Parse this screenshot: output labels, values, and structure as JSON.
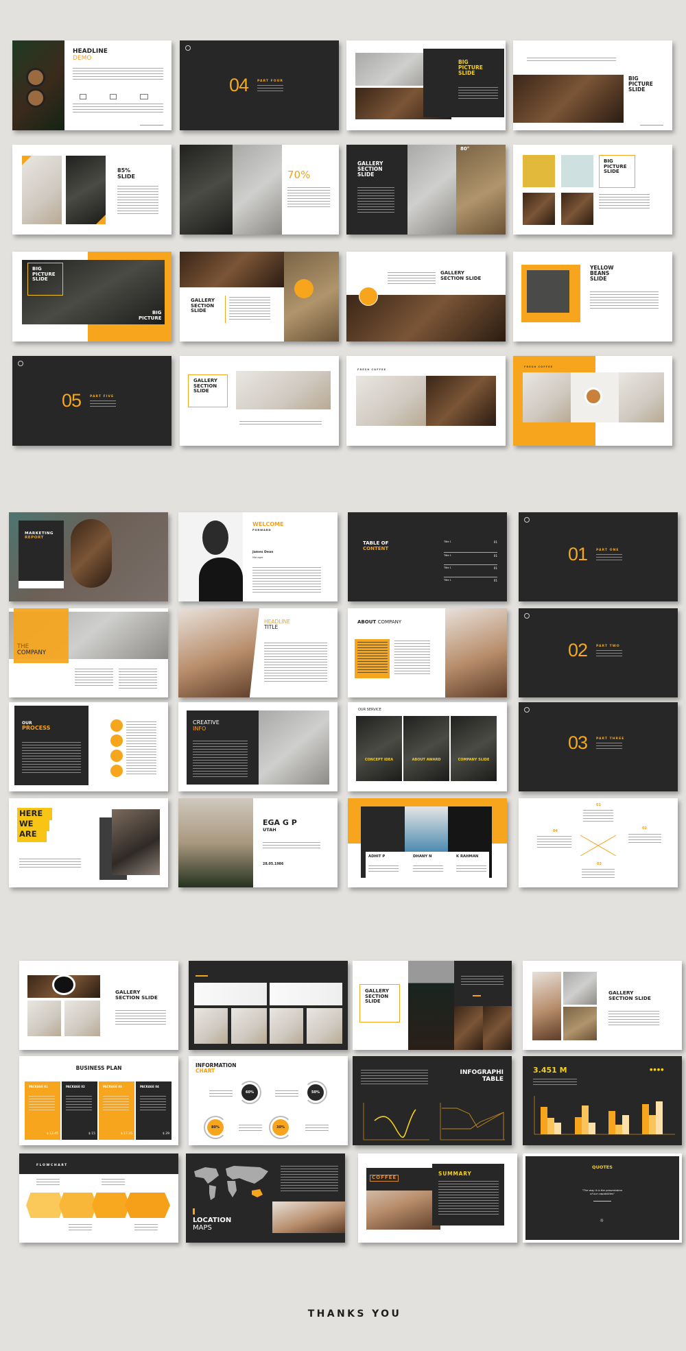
{
  "colors": {
    "background": "#e2e1de",
    "dark": "#272727",
    "orange": "#f6a51d",
    "yellow": "#f4d01e"
  },
  "section1": {
    "headline_demo": {
      "line1": "HEADLINE",
      "line2": "DEMO"
    },
    "part_four": {
      "number": "04",
      "label": "PART FOUR"
    },
    "big_picture_a": {
      "line1": "BIG",
      "line2": "PICTURE",
      "line3": "SLIDE"
    },
    "big_picture_b": {
      "line1": "BIG",
      "line2": "PICTURE",
      "line3": "SLIDE"
    },
    "slide_85": {
      "line1": "85%",
      "line2": "SLIDE"
    },
    "slide_70": {
      "value": "70%"
    },
    "gallery_a": {
      "line1": "GALLERY",
      "line2": "SECTION",
      "line3": "SLIDE",
      "badge": "80°"
    },
    "big_picture_c": {
      "line1": "BIG",
      "line2": "PICTURE",
      "line3": "SLIDE"
    },
    "big_picture_street": {
      "line1": "BIG",
      "line2": "PICTURE",
      "line3": "SLIDE",
      "corner1": "BIG",
      "corner2": "PICTURE"
    },
    "gallery_b": {
      "line1": "GALLERY",
      "line2": "SECTION",
      "line3": "SLIDE"
    },
    "gallery_c": {
      "line1": "GALLERY",
      "line2": "SECTION SLIDE"
    },
    "yellow_beans": {
      "line1": "YELLOW",
      "line2": "BEANS",
      "line3": "SLIDE"
    },
    "part_five": {
      "number": "05",
      "label": "PART FIVE"
    },
    "gallery_d": {
      "line1": "GALLERY",
      "line2": "SECTION",
      "line3": "SLIDE"
    },
    "fresh_coffee_a": {
      "label": "FRESH COFFEE"
    },
    "fresh_coffee_b": {
      "label": "FRESH COFFEE"
    }
  },
  "section2": {
    "marketing_report": {
      "line1": "MARKETING",
      "line2": "REPORT"
    },
    "welcome": {
      "line1": "WELCOME",
      "line2": "FORWARD",
      "name": "James Dean",
      "role": "Manager"
    },
    "toc": {
      "line1": "TABLE OF",
      "line2": "CONTENT",
      "items": [
        {
          "title": "Title 1",
          "num": "01"
        },
        {
          "title": "Title 1",
          "num": "01"
        },
        {
          "title": "Title 1",
          "num": "01"
        },
        {
          "title": "Title 1",
          "num": "01"
        }
      ]
    },
    "part_one": {
      "number": "01",
      "label": "PART ONE"
    },
    "the_company": {
      "line1": "THE",
      "line2": "COMPANY"
    },
    "headline_title": {
      "line1": "HEADLINE",
      "line2": "TITLE"
    },
    "about_company": {
      "bold": "ABOUT",
      "rest": "COMPANY"
    },
    "part_two": {
      "number": "02",
      "label": "PART TWO"
    },
    "our_process": {
      "line1": "OUR",
      "line2": "PROCESS"
    },
    "creative_info": {
      "line1": "CREATIVE",
      "line2": "INFO"
    },
    "our_service": {
      "title": "OUR SERVICE",
      "cards": [
        "CONCEPT IDEA",
        "ABOUT AWARD",
        "COMPANY SLIDE"
      ]
    },
    "part_three": {
      "number": "03",
      "label": "PART THREE"
    },
    "here_we_are": {
      "line1": "HERE",
      "line2": "WE",
      "line3": "ARE"
    },
    "profile": {
      "name": "EGA G P",
      "place": "UTAH",
      "date": "28.05.1986"
    },
    "team": {
      "members": [
        "ADHIT P",
        "DHANY N",
        "K RAHMAN"
      ]
    },
    "cycle": {
      "steps": [
        "01",
        "02",
        "03",
        "04"
      ]
    }
  },
  "section3": {
    "gallery_e": {
      "line1": "GALLERY",
      "line2": "SECTION SLIDE"
    },
    "gallery_f": {
      "line1": "GALLERY",
      "line2": "SECTION",
      "line3": "SLIDE"
    },
    "gallery_g": {
      "line1": "GALLERY",
      "line2": "SECTION SLIDE"
    },
    "business_plan": {
      "title": "BUSINESS PLAN",
      "packages": [
        {
          "name": "PACKAGE 01",
          "price": "$ 12.45"
        },
        {
          "name": "PACKAGE 02",
          "price": "$ 15"
        },
        {
          "name": "PACKAGE 03",
          "price": "$ 17.35"
        },
        {
          "name": "PACKAGE 04",
          "price": "$ 29"
        }
      ]
    },
    "info_chart": {
      "line1": "INFORMATION",
      "line2": "CHART",
      "values": [
        "60%",
        "50%",
        "80%",
        "30%"
      ]
    },
    "infographic": {
      "line1": "INFOGRAPHI",
      "line2": "TABLE"
    },
    "stat": {
      "value": "3.451 M"
    },
    "flowchart": {
      "title": "FLOWCHART"
    },
    "location": {
      "line1": "LOCATION",
      "line2": "MAPS"
    },
    "summary": {
      "title": "SUMMARY",
      "sign": "COFFEE"
    },
    "quotes": {
      "title": "QUOTES",
      "quote": "\"The way it is the presentation of our capabilities\""
    }
  },
  "footer": {
    "thanks": "THANKS YOU"
  }
}
